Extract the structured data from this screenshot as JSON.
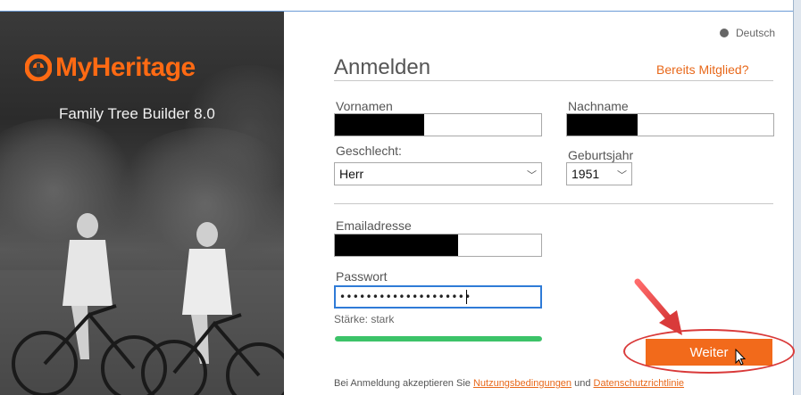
{
  "branding": {
    "logo_text": "MyHeritage",
    "product_name": "Family Tree Builder 8.0",
    "brand_color": "#ff6a13"
  },
  "language": {
    "label": "Deutsch",
    "icon": "globe-icon"
  },
  "form": {
    "title": "Anmelden",
    "member_link": "Bereits Mitglied?",
    "first_name": {
      "label": "Vornamen",
      "value": ""
    },
    "last_name": {
      "label": "Nachname",
      "value": ""
    },
    "gender": {
      "label": "Geschlecht:",
      "selected": "Herr"
    },
    "birth_year": {
      "label": "Geburtsjahr",
      "selected": "1951"
    },
    "email": {
      "label": "Emailadresse",
      "value": ""
    },
    "password": {
      "label": "Passwort",
      "masked_value": "••••••••••••••••••••"
    },
    "strength": {
      "label": "Stärke: stark",
      "level": 1.0,
      "color": "#3cc368"
    },
    "submit_label": "Weiter",
    "accent_color": "#f26a1b"
  },
  "terms": {
    "prefix": "Bei Anmeldung akzeptieren Sie",
    "terms_link": "Nutzungsbedingungen",
    "conjunction": "und",
    "privacy_link": "Datenschutzrichtlinie"
  },
  "annotations": {
    "highlight_color": "#d93a3a"
  }
}
